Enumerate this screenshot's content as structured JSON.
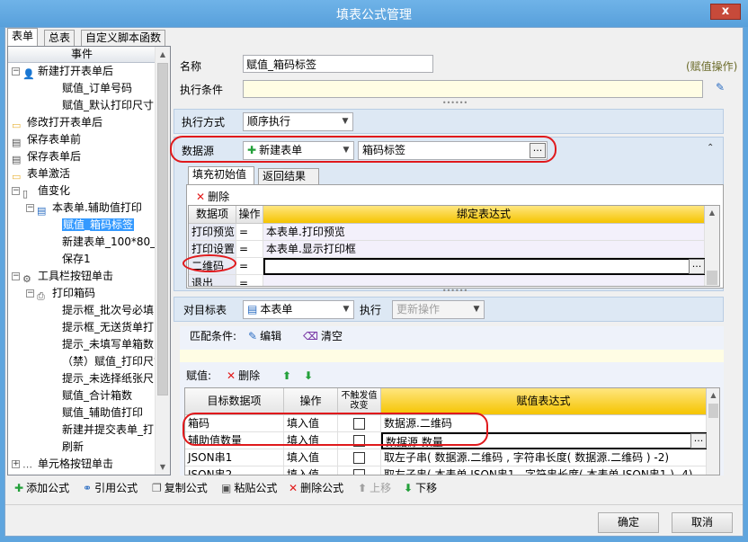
{
  "window": {
    "title": "填表公式管理",
    "close_label": "x"
  },
  "tabs": [
    "表单",
    "总表",
    "自定义脚本函数"
  ],
  "left_panel": {
    "header": "事件",
    "tree": [
      {
        "label": "新建打开表单后",
        "level": 0,
        "exp": "−",
        "icon": "user-doc-icon"
      },
      {
        "label": "赋值_订单号码",
        "level": 2
      },
      {
        "label": "赋值_默认打印尺寸",
        "level": 2
      },
      {
        "label": "修改打开表单后",
        "level": 0,
        "icon": "folder-icon"
      },
      {
        "label": "保存表单前",
        "level": 0,
        "icon": "save-icon"
      },
      {
        "label": "保存表单后",
        "level": 0,
        "icon": "save-icon"
      },
      {
        "label": "表单激活",
        "level": 0,
        "icon": "folder-icon"
      },
      {
        "label": "值变化",
        "level": 0,
        "exp": "−",
        "icon": "doc-icon"
      },
      {
        "label": "本表单.辅助值打印",
        "level": 1,
        "exp": "−",
        "icon": "table-icon"
      },
      {
        "label": "赋值_箱码标签",
        "level": 2,
        "selected": true
      },
      {
        "label": "新建表单_100*80_",
        "level": 2
      },
      {
        "label": "保存1",
        "level": 2
      },
      {
        "label": "工具栏按钮单击",
        "level": 0,
        "exp": "−",
        "icon": "gear-icon"
      },
      {
        "label": "打印箱码",
        "level": 1,
        "exp": "−",
        "icon": "print-icon"
      },
      {
        "label": "提示框_批次号必填",
        "level": 2
      },
      {
        "label": "提示框_无送货单打",
        "level": 2
      },
      {
        "label": "提示_未填写单箱数",
        "level": 2
      },
      {
        "label": "（禁）赋值_打印尺寸",
        "level": 2
      },
      {
        "label": "提示_未选择纸张尺",
        "level": 2
      },
      {
        "label": "赋值_合计箱数",
        "level": 2
      },
      {
        "label": "赋值_辅助值打印",
        "level": 2
      },
      {
        "label": "新建并提交表单_打",
        "level": 2
      },
      {
        "label": "刷新",
        "level": 2
      },
      {
        "label": "单元格按钮单击",
        "level": 0,
        "exp": "+",
        "icon": "dots-icon"
      }
    ]
  },
  "form": {
    "name_label": "名称",
    "name_value": "赋值_箱码标签",
    "op_type": "(赋值操作)",
    "condition_label": "执行条件",
    "condition_value": "",
    "exec_mode_label": "执行方式",
    "exec_mode_value": "顺序执行",
    "datasource_label": "数据源",
    "datasource_type": "新建表单",
    "datasource_value": "箱码标签",
    "ellipsis": "...",
    "subtabs": [
      "填充初始值",
      "返回结果"
    ],
    "delete_label": "删除"
  },
  "init_grid": {
    "headers": [
      "数据项",
      "操作",
      "绑定表达式"
    ],
    "rows": [
      {
        "item": "打印预览",
        "op": "=",
        "expr": "本表单.打印预览"
      },
      {
        "item": "打印设置",
        "op": "=",
        "expr": "本表单.显示打印框"
      },
      {
        "item": "二维码",
        "op": "=",
        "expr": ""
      },
      {
        "item": "退出",
        "op": "=",
        "expr": ""
      }
    ]
  },
  "target": {
    "label": "对目标表",
    "value": "本表单",
    "exec_label": "执行",
    "exec_value": "更新操作",
    "match_label": "匹配条件:",
    "edit_label": "编辑",
    "clear_label": "清空",
    "assign_label": "赋值:",
    "assign_delete_label": "删除"
  },
  "assign_grid": {
    "headers": [
      "目标数据项",
      "操作",
      "不触发值改变",
      "赋值表达式"
    ],
    "rows": [
      {
        "item": "箱码",
        "op": "填入值",
        "checked": false,
        "expr": "数据源.二维码"
      },
      {
        "item": "辅助值数量",
        "op": "填入值",
        "checked": false,
        "expr": "数据源.数量"
      },
      {
        "item": "JSON串1",
        "op": "填入值",
        "checked": false,
        "expr": "取左子串( 数据源.二维码 , 字符串长度( 数据源.二维码 ) -2)"
      },
      {
        "item": "JSON串2",
        "op": "填入值",
        "checked": false,
        "expr": "取左子串( 本表单.JSON串1 , 字符串长度( 本表单.JSON串1 ) -4)"
      }
    ]
  },
  "toolbar": {
    "add": "添加公式",
    "ref": "引用公式",
    "copy": "复制公式",
    "paste": "粘贴公式",
    "delete": "删除公式",
    "up": "上移",
    "down": "下移"
  },
  "buttons": {
    "ok": "确定",
    "cancel": "取消"
  },
  "colors": {
    "title_bar": "#5fa5de",
    "section": "#dde8f4",
    "header_yellow": "#f5c400",
    "highlight_red": "#e0191c",
    "selection": "#3399ff"
  }
}
